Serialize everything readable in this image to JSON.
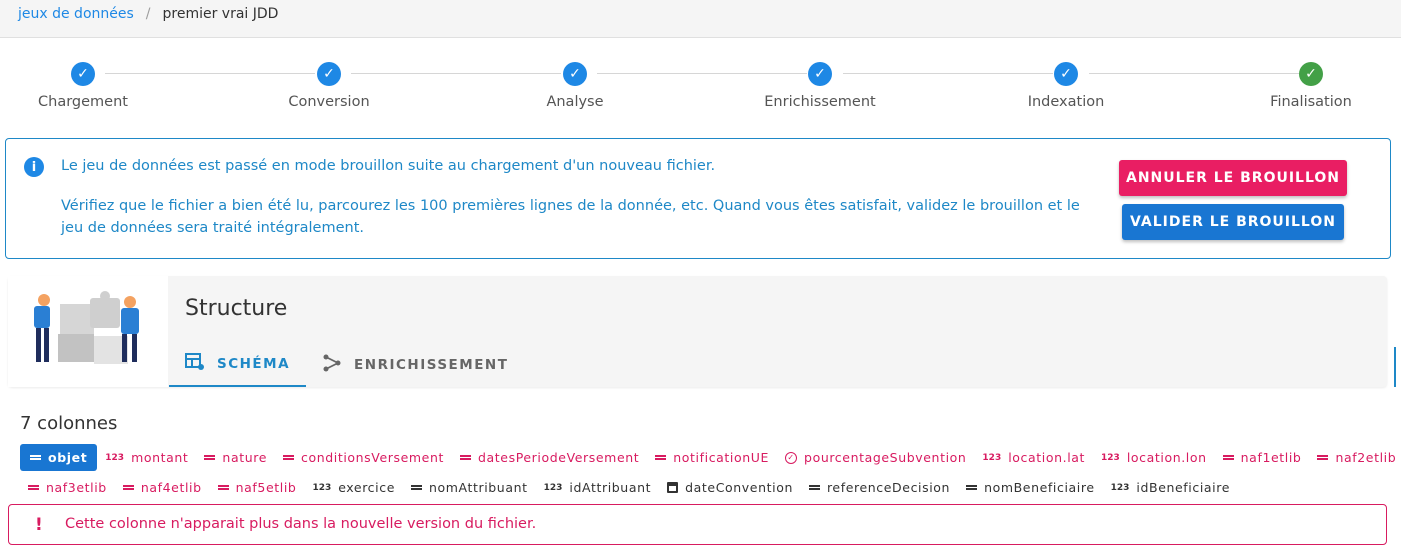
{
  "breadcrumb": {
    "parent": "jeux de données",
    "separator": "/",
    "current": "premier vrai JDD"
  },
  "stepper": {
    "steps": [
      {
        "label": "Chargement",
        "status": "done",
        "color": "#1e88e5"
      },
      {
        "label": "Conversion",
        "status": "done",
        "color": "#1e88e5"
      },
      {
        "label": "Analyse",
        "status": "done",
        "color": "#1e88e5"
      },
      {
        "label": "Enrichissement",
        "status": "done",
        "color": "#1e88e5"
      },
      {
        "label": "Indexation",
        "status": "done",
        "color": "#1e88e5"
      },
      {
        "label": "Finalisation",
        "status": "done",
        "color": "#43a047"
      }
    ]
  },
  "draft_alert": {
    "icon": "info-icon",
    "message": "Le jeu de données est passé en mode brouillon suite au chargement d'un nouveau fichier.",
    "details": "Vérifiez que le fichier a bien été lu, parcourez les 100 premières lignes de la donnée, etc. Quand vous êtes satisfait, validez le brouillon et le jeu de données sera traité intégralement.",
    "cancel_label": "ANNULER LE BROUILLON",
    "validate_label": "VALIDER LE BROUILLON"
  },
  "structure": {
    "title": "Structure",
    "tabs": [
      {
        "label": "SCHÉMA",
        "icon": "table-cog-icon",
        "active": true
      },
      {
        "label": "ENRICHISSEMENT",
        "icon": "graph-icon",
        "active": false
      }
    ]
  },
  "columns": {
    "count_label": "7 colonnes",
    "items": [
      {
        "name": "objet",
        "icon": "text-icon",
        "state": "selected"
      },
      {
        "name": "montant",
        "icon": "123",
        "state": "removed"
      },
      {
        "name": "nature",
        "icon": "text-icon",
        "state": "removed"
      },
      {
        "name": "conditionsVersement",
        "icon": "text-icon",
        "state": "removed"
      },
      {
        "name": "datesPeriodeVersement",
        "icon": "text-icon",
        "state": "removed"
      },
      {
        "name": "notificationUE",
        "icon": "text-icon",
        "state": "removed"
      },
      {
        "name": "pourcentageSubvention",
        "icon": "check-circle-icon",
        "state": "removed"
      },
      {
        "name": "location.lat",
        "icon": "123",
        "state": "removed"
      },
      {
        "name": "location.lon",
        "icon": "123",
        "state": "removed"
      },
      {
        "name": "naf1etlib",
        "icon": "text-icon",
        "state": "removed"
      },
      {
        "name": "naf2etlib",
        "icon": "text-icon",
        "state": "removed"
      },
      {
        "name": "naf3etlib",
        "icon": "text-icon",
        "state": "removed"
      },
      {
        "name": "naf4etlib",
        "icon": "text-icon",
        "state": "removed"
      },
      {
        "name": "naf5etlib",
        "icon": "text-icon",
        "state": "removed"
      },
      {
        "name": "exercice",
        "icon": "123",
        "state": "normal"
      },
      {
        "name": "nomAttribuant",
        "icon": "text-icon",
        "state": "normal"
      },
      {
        "name": "idAttribuant",
        "icon": "123",
        "state": "normal"
      },
      {
        "name": "dateConvention",
        "icon": "calendar-icon",
        "state": "normal"
      },
      {
        "name": "referenceDecision",
        "icon": "text-icon",
        "state": "normal"
      },
      {
        "name": "nomBeneficiaire",
        "icon": "text-icon",
        "state": "normal"
      },
      {
        "name": "idBeneficiaire",
        "icon": "123",
        "state": "normal"
      }
    ]
  },
  "column_warning": {
    "icon": "exclamation-icon",
    "symbol": "!",
    "message": "Cette colonne n'apparait plus dans la nouvelle version du fichier."
  }
}
